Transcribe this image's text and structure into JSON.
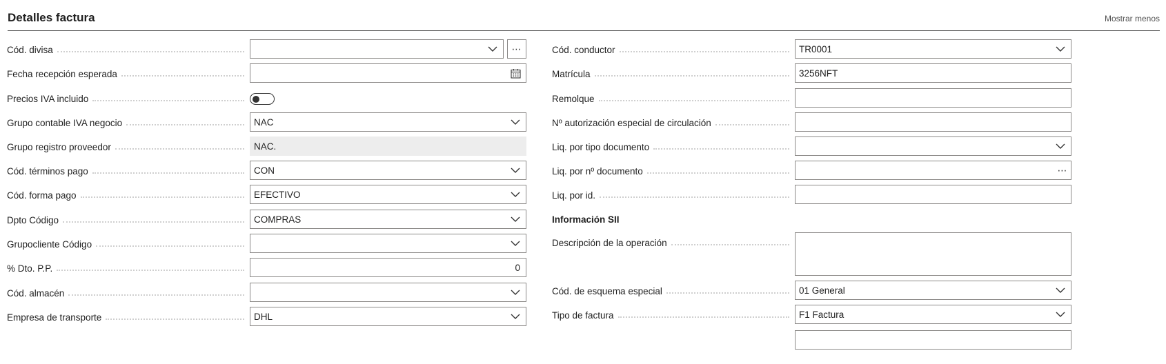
{
  "header": {
    "title": "Detalles factura",
    "toggle_label": "Mostrar menos"
  },
  "left": {
    "currency_code": {
      "label": "Cód. divisa",
      "value": "",
      "more": "⋯"
    },
    "expected_receipt_date": {
      "label": "Fecha recepción esperada",
      "value": "",
      "icon": "calendar-icon"
    },
    "prices_incl_vat": {
      "label": "Precios IVA incluido",
      "state": "off"
    },
    "vat_bus_posting_group": {
      "label": "Grupo contable IVA negocio",
      "value": "NAC"
    },
    "vendor_posting_group": {
      "label": "Grupo registro proveedor",
      "value": "NAC."
    },
    "payment_terms_code": {
      "label": "Cód. términos pago",
      "value": "CON"
    },
    "payment_method_code": {
      "label": "Cód. forma pago",
      "value": "EFECTIVO"
    },
    "dept_code": {
      "label": "Dpto Código",
      "value": "COMPRAS"
    },
    "customer_group_code": {
      "label": "Grupocliente Código",
      "value": ""
    },
    "payment_discount": {
      "label": "% Dto. P.P.",
      "value": "0"
    },
    "location_code": {
      "label": "Cód. almacén",
      "value": ""
    },
    "shipping_agent": {
      "label": "Empresa de transporte",
      "value": "DHL"
    }
  },
  "right": {
    "driver_code": {
      "label": "Cód. conductor",
      "value": "TR0001"
    },
    "license_plate": {
      "label": "Matrícula",
      "value": "3256NFT"
    },
    "trailer": {
      "label": "Remolque",
      "value": ""
    },
    "special_permit_no": {
      "label": "Nº autorización especial de circulación",
      "value": ""
    },
    "applies_to_doc_type": {
      "label": "Liq. por tipo documento",
      "value": ""
    },
    "applies_to_doc_no": {
      "label": "Liq. por nº documento",
      "value": "",
      "more": "⋯"
    },
    "applies_to_id": {
      "label": "Liq. por id.",
      "value": ""
    },
    "sii_section": {
      "title": "Información SII"
    },
    "operation_description": {
      "label": "Descripción de la operación",
      "value": ""
    },
    "special_scheme_code": {
      "label": "Cód. de esquema especial",
      "value": "01 General"
    },
    "invoice_type": {
      "label": "Tipo de factura",
      "value": "F1 Factura"
    }
  },
  "colors": {
    "border": "#8a8886",
    "readonly_bg": "#ededed",
    "text": "#212121"
  }
}
